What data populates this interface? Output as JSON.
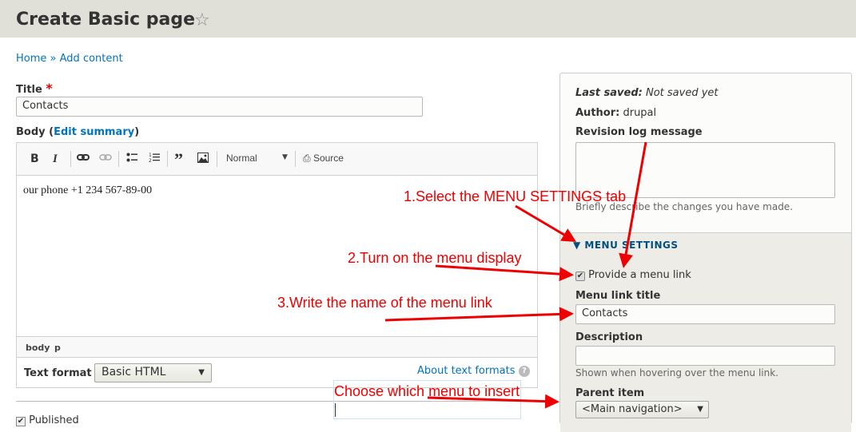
{
  "header": {
    "title": "Create Basic page",
    "star_icon": "star-outline-icon"
  },
  "breadcrumb": {
    "home": "Home",
    "separator": "»",
    "add_content": "Add content"
  },
  "form": {
    "title_label": "Title",
    "required_mark": "*",
    "title_value": "Contacts",
    "body_label": "Body (",
    "edit_summary": "Edit summary",
    "body_label_end": ")",
    "toolbar": {
      "bold": "B",
      "italic": "I",
      "format_select": "Normal",
      "source": "Source",
      "icons": [
        "bold-icon",
        "italic-icon",
        "link-icon",
        "unlink-icon",
        "bullet-list-icon",
        "numbered-list-icon",
        "blockquote-icon",
        "image-icon",
        "source-icon"
      ]
    },
    "body_content": "our phone +1 234 567-89-00",
    "status_path": [
      "body",
      "p"
    ],
    "text_format_label": "Text format",
    "text_format_value": "Basic HTML",
    "about_formats": "About text formats",
    "help_icon": "?",
    "published_label": "Published"
  },
  "sidebar": {
    "last_saved_label": "Last saved:",
    "last_saved_value": "Not saved yet",
    "author_label": "Author:",
    "author_value": "drupal",
    "revision_label": "Revision log message",
    "revision_value": "",
    "revision_desc": "Briefly describe the changes you have made.",
    "menu_settings": "MENU SETTINGS",
    "provide_link_label": "Provide a menu link",
    "provide_link_checked": true,
    "menu_link_title_label": "Menu link title",
    "menu_link_title_value": "Contacts",
    "description_label": "Description",
    "description_value": "",
    "description_help": "Shown when hovering over the menu link.",
    "parent_item_label": "Parent item",
    "parent_item_value": "<Main navigation>"
  },
  "annotations": {
    "step1": "1.Select the MENU SETTINGS tab",
    "step2": "2.Turn on the menu display",
    "step3": "3.Write the name of the menu link",
    "step4": "Choose which menu to insert",
    "color": "#e00000"
  },
  "colors": {
    "header_bg": "#e0dfd8",
    "link": "#0074bd",
    "menu_settings": "#004f80",
    "sidebar_bg": "#fcfcfa",
    "menu_bg": "#edece7"
  }
}
